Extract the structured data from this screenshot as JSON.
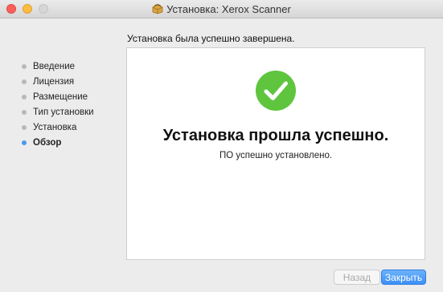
{
  "window": {
    "title": "Установка: Xerox Scanner"
  },
  "header": {
    "text": "Установка была успешно завершена."
  },
  "sidebar": {
    "items": [
      {
        "label": "Введение",
        "active": false
      },
      {
        "label": "Лицензия",
        "active": false
      },
      {
        "label": "Размещение",
        "active": false
      },
      {
        "label": "Тип установки",
        "active": false
      },
      {
        "label": "Установка",
        "active": false
      },
      {
        "label": "Обзор",
        "active": true
      }
    ]
  },
  "content": {
    "icon": "checkmark-success-icon",
    "heading": "Установка прошла успешно.",
    "message": "ПО успешно установлено."
  },
  "buttons": {
    "back_label": "Назад",
    "close_label": "Закрыть"
  },
  "colors": {
    "success_green": "#5fc53e",
    "accent_blue": "#3d8ff5",
    "active_dot": "#4a98ec"
  }
}
